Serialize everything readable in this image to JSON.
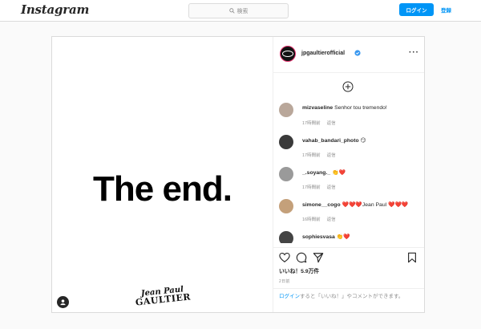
{
  "nav": {
    "logo": "Instagram",
    "search_placeholder": "検索",
    "login_label": "ログイン",
    "signup_label": "登録"
  },
  "post": {
    "image_text": "The end.",
    "brand_line1": "Jean Paul",
    "brand_line2": "GAULTIER",
    "owner": "jpgaultierofficial",
    "comments": [
      {
        "user": "mizvaseline",
        "text": "Senhor tou tremendo!",
        "time": "17時間前",
        "reply": "返信",
        "avatar_color": "#b9a79a"
      },
      {
        "user": "vahab_bandari_photo",
        "text": "😏",
        "time": "17時間前",
        "reply": "返信",
        "avatar_color": "#3a3a3a"
      },
      {
        "user": "_.soyang._",
        "text": "👏❤️",
        "time": "17時間前",
        "reply": "返信",
        "avatar_color": "#9a9a9a"
      },
      {
        "user": "simone__cogo",
        "text": "❤️❤️❤️Jean Paul ❤️❤️❤️",
        "time": "16時間前",
        "reply": "返信",
        "avatar_color": "#c4a07a"
      },
      {
        "user": "sophiesvasa",
        "text": "👏❤️",
        "time": "",
        "reply": "",
        "avatar_color": "#444444"
      }
    ],
    "likes": "いいね！5.9万件",
    "date": "2日前",
    "login_link": "ログイン",
    "login_rest": "すると「いいね！」やコメントができます。"
  },
  "colors": {
    "accent": "#0095f6",
    "heart": "#ed4956",
    "story_ring": "#e1306c"
  }
}
